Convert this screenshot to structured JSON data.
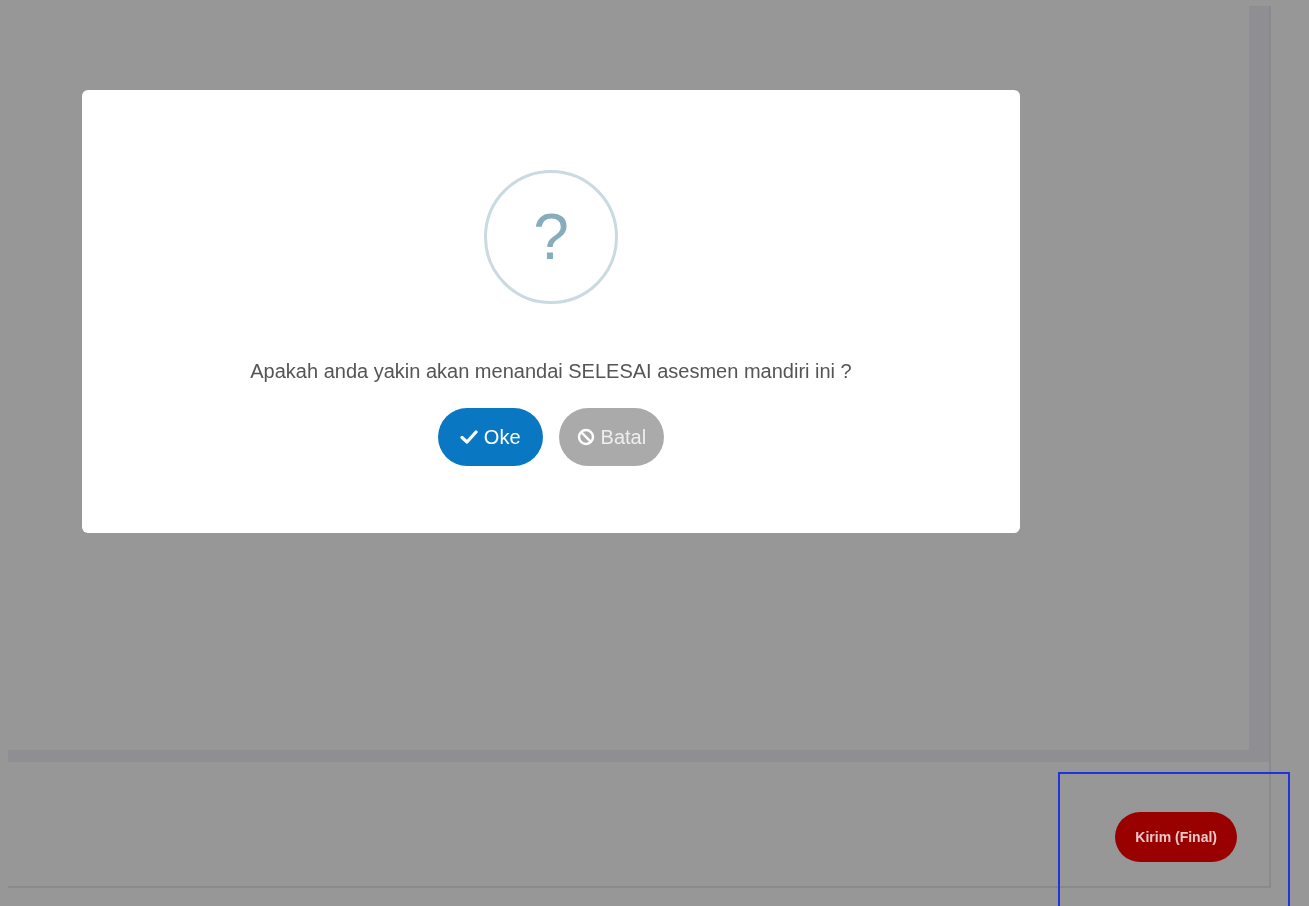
{
  "dialog": {
    "icon": "?",
    "message": "Apakah anda yakin akan menandai SELESAI asesmen mandiri ini ?",
    "buttons": [
      {
        "kind": "confirm",
        "label": "Oke"
      },
      {
        "kind": "cancel",
        "label": "Batal"
      }
    ]
  },
  "footer": {
    "submit_button": "Kirim (Final)",
    "highlighted": true
  }
}
